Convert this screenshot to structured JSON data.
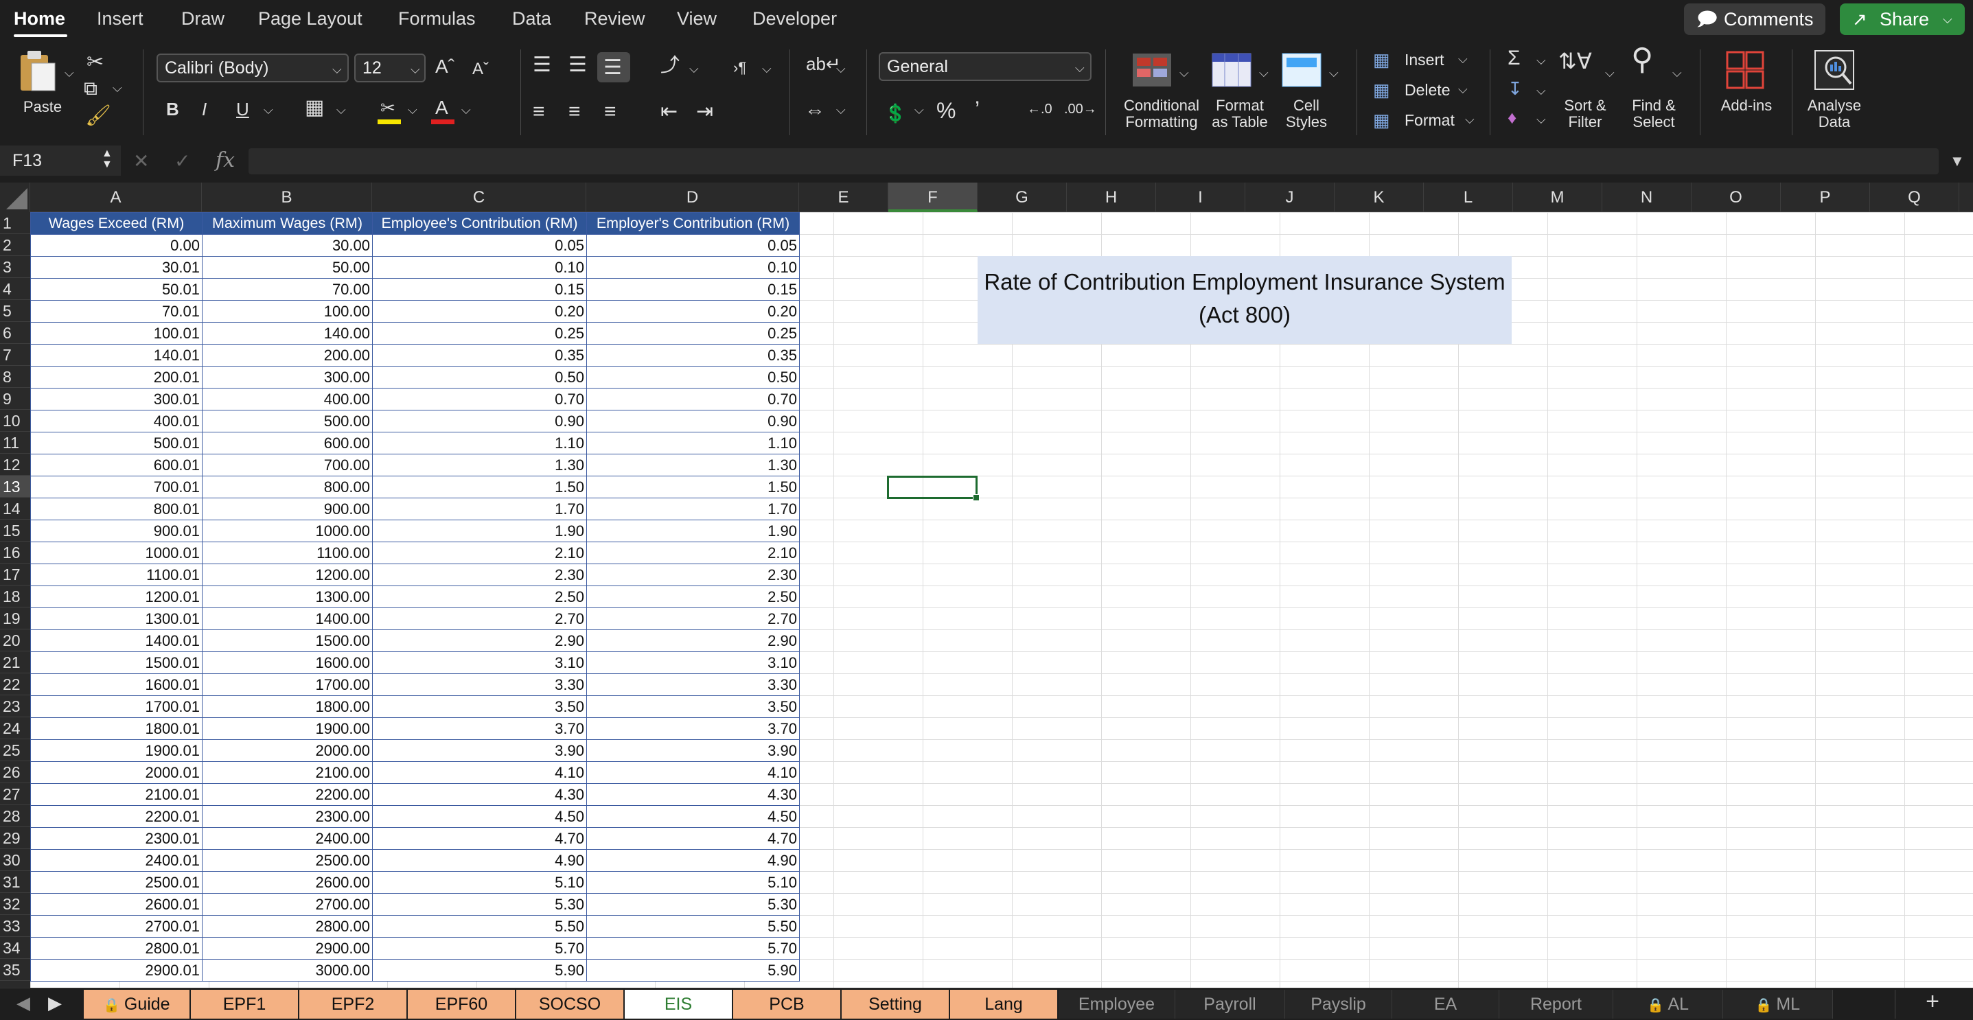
{
  "menu": {
    "items": [
      "Home",
      "Insert",
      "Draw",
      "Page Layout",
      "Formulas",
      "Data",
      "Review",
      "View",
      "Developer"
    ],
    "comments": "Comments",
    "share": "Share"
  },
  "ribbon": {
    "paste": "Paste",
    "font_name": "Calibri (Body)",
    "font_size": "12",
    "number_format": "General",
    "conditional": "Conditional\nFormatting",
    "format_table": "Format\nas Table",
    "cell_styles": "Cell\nStyles",
    "insert": "Insert",
    "delete": "Delete",
    "format": "Format",
    "sort": "Sort &\nFilter",
    "find": "Find &\nSelect",
    "addins": "Add-ins",
    "analyse": "Analyse\nData",
    "colors": {
      "highlight": "#f7e600",
      "font": "#e02020"
    }
  },
  "formula_bar": {
    "name_box": "F13",
    "fx": "fx",
    "value": ""
  },
  "grid": {
    "columns": [
      "A",
      "B",
      "C",
      "D",
      "E",
      "F",
      "G",
      "H",
      "I",
      "J",
      "K",
      "L",
      "M",
      "N",
      "O",
      "P",
      "Q"
    ],
    "selected_column": "F",
    "selected_row": "13",
    "rows": [
      "1",
      "2",
      "3",
      "4",
      "5",
      "6",
      "7",
      "8",
      "9",
      "10",
      "11",
      "12",
      "13",
      "14",
      "15",
      "16",
      "17",
      "18",
      "19",
      "20",
      "21",
      "22",
      "23",
      "24",
      "25",
      "26",
      "27",
      "28",
      "29",
      "30",
      "31",
      "32",
      "33",
      "34",
      "35"
    ],
    "headers": [
      "Wages Exceed (RM)",
      "Maximum Wages (RM)",
      "Employee's Contribution (RM)",
      "Employer's Contribution (RM)"
    ],
    "data": [
      [
        "0.00",
        "30.00",
        "0.05",
        "0.05"
      ],
      [
        "30.01",
        "50.00",
        "0.10",
        "0.10"
      ],
      [
        "50.01",
        "70.00",
        "0.15",
        "0.15"
      ],
      [
        "70.01",
        "100.00",
        "0.20",
        "0.20"
      ],
      [
        "100.01",
        "140.00",
        "0.25",
        "0.25"
      ],
      [
        "140.01",
        "200.00",
        "0.35",
        "0.35"
      ],
      [
        "200.01",
        "300.00",
        "0.50",
        "0.50"
      ],
      [
        "300.01",
        "400.00",
        "0.70",
        "0.70"
      ],
      [
        "400.01",
        "500.00",
        "0.90",
        "0.90"
      ],
      [
        "500.01",
        "600.00",
        "1.10",
        "1.10"
      ],
      [
        "600.01",
        "700.00",
        "1.30",
        "1.30"
      ],
      [
        "700.01",
        "800.00",
        "1.50",
        "1.50"
      ],
      [
        "800.01",
        "900.00",
        "1.70",
        "1.70"
      ],
      [
        "900.01",
        "1000.00",
        "1.90",
        "1.90"
      ],
      [
        "1000.01",
        "1100.00",
        "2.10",
        "2.10"
      ],
      [
        "1100.01",
        "1200.00",
        "2.30",
        "2.30"
      ],
      [
        "1200.01",
        "1300.00",
        "2.50",
        "2.50"
      ],
      [
        "1300.01",
        "1400.00",
        "2.70",
        "2.70"
      ],
      [
        "1400.01",
        "1500.00",
        "2.90",
        "2.90"
      ],
      [
        "1500.01",
        "1600.00",
        "3.10",
        "3.10"
      ],
      [
        "1600.01",
        "1700.00",
        "3.30",
        "3.30"
      ],
      [
        "1700.01",
        "1800.00",
        "3.50",
        "3.50"
      ],
      [
        "1800.01",
        "1900.00",
        "3.70",
        "3.70"
      ],
      [
        "1900.01",
        "2000.00",
        "3.90",
        "3.90"
      ],
      [
        "2000.01",
        "2100.00",
        "4.10",
        "4.10"
      ],
      [
        "2100.01",
        "2200.00",
        "4.30",
        "4.30"
      ],
      [
        "2200.01",
        "2300.00",
        "4.50",
        "4.50"
      ],
      [
        "2300.01",
        "2400.00",
        "4.70",
        "4.70"
      ],
      [
        "2400.01",
        "2500.00",
        "4.90",
        "4.90"
      ],
      [
        "2500.01",
        "2600.00",
        "5.10",
        "5.10"
      ],
      [
        "2600.01",
        "2700.00",
        "5.30",
        "5.30"
      ],
      [
        "2700.01",
        "2800.00",
        "5.50",
        "5.50"
      ],
      [
        "2800.01",
        "2900.00",
        "5.70",
        "5.70"
      ],
      [
        "2900.01",
        "3000.00",
        "5.90",
        "5.90"
      ]
    ],
    "title_line1": "Rate of Contribution Employment Insurance System",
    "title_line2": "(Act 800)"
  },
  "sheets": {
    "tabs": [
      {
        "label": "Guide",
        "locked": true,
        "style": "orange"
      },
      {
        "label": "EPF1",
        "style": "orange"
      },
      {
        "label": "EPF2",
        "style": "orange"
      },
      {
        "label": "EPF60",
        "style": "orange"
      },
      {
        "label": "SOCSO",
        "style": "orange"
      },
      {
        "label": "EIS",
        "style": "active"
      },
      {
        "label": "PCB",
        "style": "orange"
      },
      {
        "label": "Setting",
        "style": "orange"
      },
      {
        "label": "Lang",
        "style": "orange"
      },
      {
        "label": "Employee",
        "style": "gray"
      },
      {
        "label": "Payroll",
        "style": "gray"
      },
      {
        "label": "Payslip",
        "style": "gray"
      },
      {
        "label": "EA",
        "style": "gray"
      },
      {
        "label": "Report",
        "style": "gray"
      },
      {
        "label": "AL",
        "locked": true,
        "style": "gray"
      },
      {
        "label": "ML",
        "locked": true,
        "style": "gray"
      }
    ],
    "add": "+"
  }
}
